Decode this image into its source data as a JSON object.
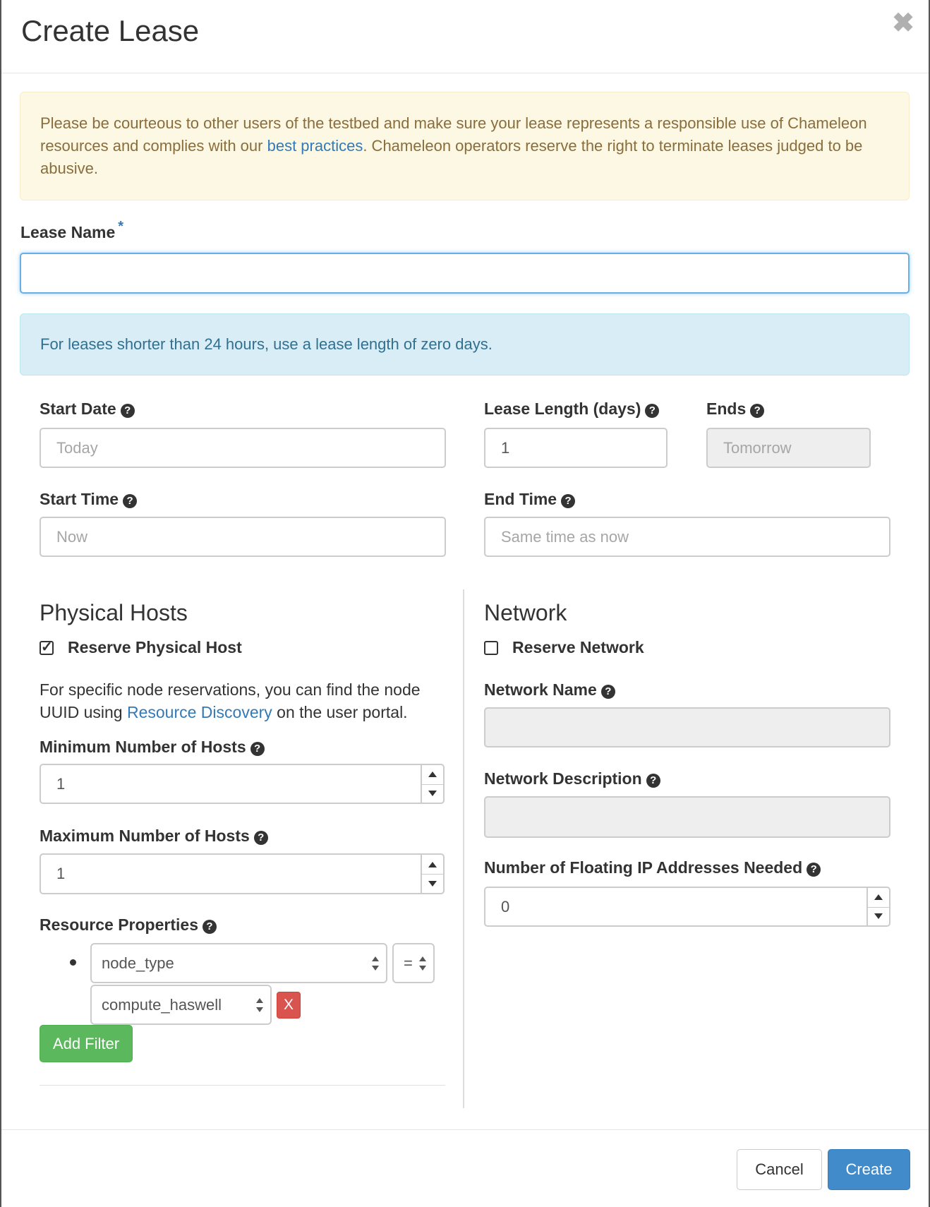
{
  "dialog": {
    "title": "Create Lease",
    "close_symbol": "✖"
  },
  "notice": {
    "text_before": "Please be courteous to other users of the testbed and make sure your lease represents a responsible use of Chameleon resources and complies with our ",
    "link": "best practices",
    "text_after": ". Chameleon operators reserve the right to terminate leases judged to be abusive."
  },
  "lease_name": {
    "label": "Lease Name",
    "required_mark": "*",
    "value": ""
  },
  "info": {
    "text": "For leases shorter than 24 hours, use a lease length of zero days."
  },
  "help_symbol": "?",
  "start_date": {
    "label": "Start Date",
    "placeholder": "Today"
  },
  "lease_length": {
    "label": "Lease Length (days)",
    "value": "1"
  },
  "ends": {
    "label": "Ends",
    "placeholder": "Tomorrow"
  },
  "start_time": {
    "label": "Start Time",
    "placeholder": "Now"
  },
  "end_time": {
    "label": "End Time",
    "placeholder": "Same time as now"
  },
  "physical_hosts": {
    "title": "Physical Hosts",
    "reserve_label": "Reserve Physical Host",
    "reserve_checked": true,
    "helper_before": "For specific node reservations, you can find the node UUID using ",
    "helper_link": "Resource Discovery",
    "helper_after": " on the user portal.",
    "min_label": "Minimum Number of Hosts",
    "min_value": "1",
    "max_label": "Maximum Number of Hosts",
    "max_value": "1",
    "resource_label": "Resource Properties",
    "filter": {
      "property": "node_type",
      "operator": "=",
      "value": "compute_haswell",
      "remove": "X"
    },
    "add_filter": "Add Filter"
  },
  "network": {
    "title": "Network",
    "reserve_label": "Reserve Network",
    "reserve_checked": false,
    "name_label": "Network Name",
    "name_value": "",
    "description_label": "Network Description",
    "description_value": "",
    "floating_label": "Number of Floating IP Addresses Needed",
    "floating_value": "0"
  },
  "footer": {
    "cancel": "Cancel",
    "create": "Create"
  }
}
